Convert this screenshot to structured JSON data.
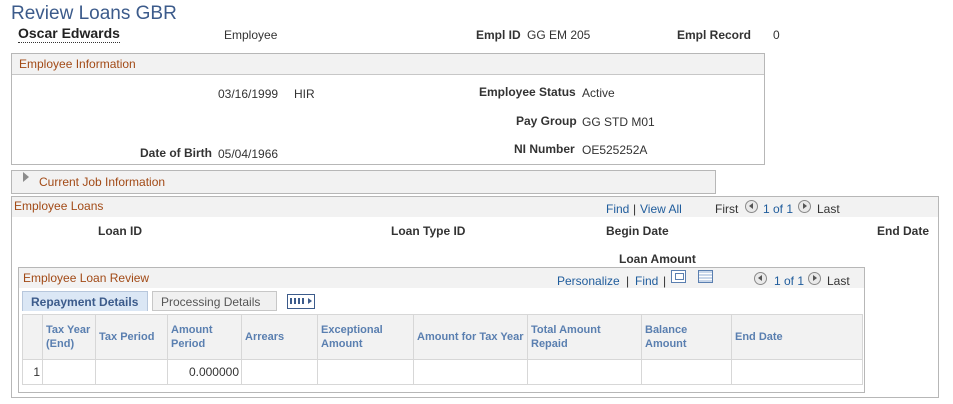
{
  "page": {
    "title": "Review Loans GBR"
  },
  "employee": {
    "name": "Oscar Edwards",
    "role": "Employee",
    "empl_id_label": "Empl ID",
    "empl_id": "GG EM 205",
    "empl_record_label": "Empl Record",
    "empl_record": "0"
  },
  "employee_info": {
    "header": "Employee Information",
    "hire_date": "03/16/1999",
    "action": "HIR",
    "status_label": "Employee Status",
    "status": "Active",
    "pay_group_label": "Pay Group",
    "pay_group": "GG STD M01",
    "dob_label": "Date of Birth",
    "dob": "05/04/1966",
    "ni_label": "NI Number",
    "ni": "OE525252A"
  },
  "current_job": {
    "header": "Current Job Information"
  },
  "employee_loans": {
    "header": "Employee Loans",
    "find": "Find",
    "sep": "|",
    "view_all": "View All",
    "first": "First",
    "range": "1 of 1",
    "last": "Last",
    "col_loan_id": "Loan ID",
    "col_loan_type": "Loan Type ID",
    "col_begin": "Begin Date",
    "col_end": "End Date",
    "col_amount": "Loan Amount"
  },
  "loan_review": {
    "header": "Employee Loan Review",
    "personalize": "Personalize",
    "sep": "|",
    "find": "Find",
    "sep2": "|",
    "range": "1 of 1",
    "last": "Last",
    "tabs": [
      "Repayment Details",
      "Processing Details"
    ],
    "columns": [
      "Tax Year (End)",
      "Tax Period",
      "Amount Period",
      "Arrears",
      "Exceptional Amount",
      "Amount for Tax Year",
      "Total Amount Repaid",
      "Balance Amount",
      "End Date"
    ],
    "rows": [
      {
        "num": "1",
        "tax_year": "",
        "tax_period": "",
        "amount_period": "0.000000",
        "arrears": "",
        "exceptional": "",
        "amount_tax_year": "",
        "total_repaid": "",
        "balance": "",
        "end_date": ""
      }
    ]
  }
}
